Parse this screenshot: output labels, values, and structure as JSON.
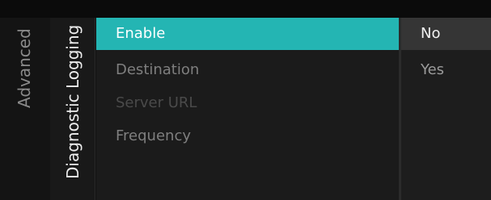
{
  "breadcrumb": {
    "parent": "Advanced",
    "current": "Diagnostic Logging"
  },
  "options": [
    {
      "label": "Enable",
      "state": "selected"
    },
    {
      "label": "Destination",
      "state": "normal"
    },
    {
      "label": "Server URL",
      "state": "disabled"
    },
    {
      "label": "Frequency",
      "state": "normal"
    }
  ],
  "values": [
    {
      "label": "No",
      "state": "selected"
    },
    {
      "label": "Yes",
      "state": "normal"
    }
  ],
  "colors": {
    "accent": "#24b5b3",
    "background": "#1b1b1b",
    "selected_value": "#353535"
  }
}
